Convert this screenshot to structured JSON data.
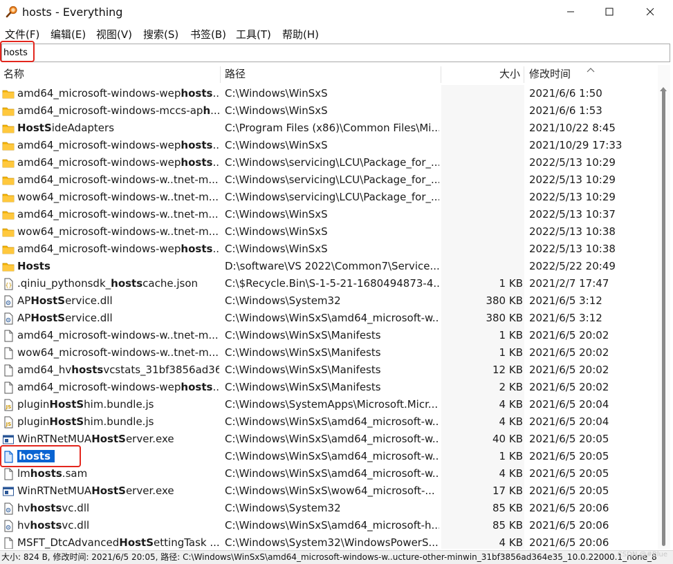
{
  "window": {
    "title": "hosts - Everything",
    "controls": {
      "minimize": "minimize",
      "maximize": "maximize",
      "close": "close"
    }
  },
  "menu": [
    "文件(F)",
    "编辑(E)",
    "视图(V)",
    "搜索(S)",
    "书签(B)",
    "工具(T)",
    "帮助(H)"
  ],
  "search": {
    "value": "hosts",
    "placeholder": ""
  },
  "columns": {
    "name": "名称",
    "path": "路径",
    "size": "大小",
    "modified": "修改时间"
  },
  "sort": {
    "column": "modified",
    "direction": "ascending"
  },
  "colors": {
    "selection": "#0a64d2",
    "annotation": "#e3261d",
    "folder": "#f5b400"
  },
  "rows": [
    {
      "icon": "folder",
      "name_parts": [
        [
          "amd64_microsoft-windows-wep",
          0
        ],
        [
          "hosts",
          1
        ],
        [
          "...",
          0
        ]
      ],
      "path": "C:\\Windows\\WinSxS",
      "size": "",
      "modified": "2021/6/6 1:50"
    },
    {
      "icon": "folder",
      "name_parts": [
        [
          "amd64_microsoft-windows-mccs-ap",
          0
        ],
        [
          "h",
          1
        ],
        [
          "...",
          0
        ]
      ],
      "path": "C:\\Windows\\WinSxS",
      "size": "",
      "modified": "2021/6/6 1:53"
    },
    {
      "icon": "folder",
      "name_parts": [
        [
          "HostS",
          1
        ],
        [
          "ideAdapters",
          0
        ]
      ],
      "path": "C:\\Program Files (x86)\\Common Files\\Mi...",
      "size": "",
      "modified": "2021/10/22 8:45"
    },
    {
      "icon": "folder",
      "name_parts": [
        [
          "amd64_microsoft-windows-wep",
          0
        ],
        [
          "hosts",
          1
        ],
        [
          "...",
          0
        ]
      ],
      "path": "C:\\Windows\\WinSxS",
      "size": "",
      "modified": "2021/10/29 17:33"
    },
    {
      "icon": "folder",
      "name_parts": [
        [
          "amd64_microsoft-windows-wep",
          0
        ],
        [
          "hosts",
          1
        ],
        [
          "...",
          0
        ]
      ],
      "path": "C:\\Windows\\servicing\\LCU\\Package_for_...",
      "size": "",
      "modified": "2022/5/13 10:29"
    },
    {
      "icon": "folder",
      "name_parts": [
        [
          "amd64_microsoft-windows-w..tnet-m...",
          0
        ]
      ],
      "path": "C:\\Windows\\servicing\\LCU\\Package_for_...",
      "size": "",
      "modified": "2022/5/13 10:29"
    },
    {
      "icon": "folder",
      "name_parts": [
        [
          "wow64_microsoft-windows-w..tnet-m...",
          0
        ]
      ],
      "path": "C:\\Windows\\servicing\\LCU\\Package_for_...",
      "size": "",
      "modified": "2022/5/13 10:29"
    },
    {
      "icon": "folder",
      "name_parts": [
        [
          "amd64_microsoft-windows-w..tnet-m...",
          0
        ]
      ],
      "path": "C:\\Windows\\WinSxS",
      "size": "",
      "modified": "2022/5/13 10:37"
    },
    {
      "icon": "folder",
      "name_parts": [
        [
          "wow64_microsoft-windows-w..tnet-m...",
          0
        ]
      ],
      "path": "C:\\Windows\\WinSxS",
      "size": "",
      "modified": "2022/5/13 10:38"
    },
    {
      "icon": "folder",
      "name_parts": [
        [
          "amd64_microsoft-windows-wep",
          0
        ],
        [
          "hosts",
          1
        ],
        [
          "...",
          0
        ]
      ],
      "path": "C:\\Windows\\WinSxS",
      "size": "",
      "modified": "2022/5/13 10:38"
    },
    {
      "icon": "folder",
      "name_parts": [
        [
          "Hosts",
          1
        ]
      ],
      "path": "D:\\software\\VS 2022\\Common7\\Service...",
      "size": "",
      "modified": "2022/5/22 20:49"
    },
    {
      "icon": "json",
      "name_parts": [
        [
          ".qiniu_pythonsdk_",
          0
        ],
        [
          "hosts",
          1
        ],
        [
          "cache.json",
          0
        ]
      ],
      "path": "C:\\$Recycle.Bin\\S-1-5-21-1680494873-4...",
      "size": "1 KB",
      "modified": "2021/2/7 17:47"
    },
    {
      "icon": "dll",
      "name_parts": [
        [
          "AP",
          0
        ],
        [
          "HostS",
          1
        ],
        [
          "ervice.dll",
          0
        ]
      ],
      "path": "C:\\Windows\\System32",
      "size": "380 KB",
      "modified": "2021/6/5 3:12"
    },
    {
      "icon": "dll",
      "name_parts": [
        [
          "AP",
          0
        ],
        [
          "HostS",
          1
        ],
        [
          "ervice.dll",
          0
        ]
      ],
      "path": "C:\\Windows\\WinSxS\\amd64_microsoft-w...",
      "size": "380 KB",
      "modified": "2021/6/5 3:12"
    },
    {
      "icon": "file",
      "name_parts": [
        [
          "amd64_microsoft-windows-w..tnet-m...",
          0
        ]
      ],
      "path": "C:\\Windows\\WinSxS\\Manifests",
      "size": "1 KB",
      "modified": "2021/6/5 20:02"
    },
    {
      "icon": "file",
      "name_parts": [
        [
          "wow64_microsoft-windows-w..tnet-m...",
          0
        ]
      ],
      "path": "C:\\Windows\\WinSxS\\Manifests",
      "size": "1 KB",
      "modified": "2021/6/5 20:02"
    },
    {
      "icon": "file",
      "name_parts": [
        [
          "amd64_hv",
          0
        ],
        [
          "hosts",
          1
        ],
        [
          "vcstats_31bf3856ad36...",
          0
        ]
      ],
      "path": "C:\\Windows\\WinSxS\\Manifests",
      "size": "12 KB",
      "modified": "2021/6/5 20:02"
    },
    {
      "icon": "file",
      "name_parts": [
        [
          "amd64_microsoft-windows-wep",
          0
        ],
        [
          "hosts",
          1
        ],
        [
          "...",
          0
        ]
      ],
      "path": "C:\\Windows\\WinSxS\\Manifests",
      "size": "2 KB",
      "modified": "2021/6/5 20:02"
    },
    {
      "icon": "js",
      "name_parts": [
        [
          "plugin",
          0
        ],
        [
          "HostS",
          1
        ],
        [
          "him.bundle.js",
          0
        ]
      ],
      "path": "C:\\Windows\\SystemApps\\Microsoft.Micr...",
      "size": "4 KB",
      "modified": "2021/6/5 20:04"
    },
    {
      "icon": "js",
      "name_parts": [
        [
          "plugin",
          0
        ],
        [
          "HostS",
          1
        ],
        [
          "him.bundle.js",
          0
        ]
      ],
      "path": "C:\\Windows\\WinSxS\\amd64_microsoft-w...",
      "size": "4 KB",
      "modified": "2021/6/5 20:04"
    },
    {
      "icon": "exe",
      "name_parts": [
        [
          "WinRTNetMUA",
          0
        ],
        [
          "HostS",
          1
        ],
        [
          "erver.exe",
          0
        ]
      ],
      "path": "C:\\Windows\\WinSxS\\amd64_microsoft-w...",
      "size": "40 KB",
      "modified": "2021/6/5 20:05"
    },
    {
      "icon": "file-selected",
      "selected": true,
      "name_parts": [
        [
          "hosts",
          1
        ]
      ],
      "path": "C:\\Windows\\WinSxS\\amd64_microsoft-w...",
      "size": "1 KB",
      "modified": "2021/6/5 20:05"
    },
    {
      "icon": "file",
      "name_parts": [
        [
          "lm",
          0
        ],
        [
          "hosts",
          1
        ],
        [
          ".sam",
          0
        ]
      ],
      "path": "C:\\Windows\\WinSxS\\amd64_microsoft-w...",
      "size": "4 KB",
      "modified": "2021/6/5 20:05"
    },
    {
      "icon": "exe",
      "name_parts": [
        [
          "WinRTNetMUA",
          0
        ],
        [
          "HostS",
          1
        ],
        [
          "erver.exe",
          0
        ]
      ],
      "path": "C:\\Windows\\WinSxS\\wow64_microsoft-...",
      "size": "17 KB",
      "modified": "2021/6/5 20:05"
    },
    {
      "icon": "dll",
      "name_parts": [
        [
          "hv",
          0
        ],
        [
          "hosts",
          1
        ],
        [
          "vc.dll",
          0
        ]
      ],
      "path": "C:\\Windows\\System32",
      "size": "85 KB",
      "modified": "2021/6/5 20:06"
    },
    {
      "icon": "dll",
      "name_parts": [
        [
          "hv",
          0
        ],
        [
          "hosts",
          1
        ],
        [
          "vc.dll",
          0
        ]
      ],
      "path": "C:\\Windows\\WinSxS\\amd64_microsoft-h...",
      "size": "85 KB",
      "modified": "2021/6/5 20:06"
    },
    {
      "icon": "file",
      "name_parts": [
        [
          "MSFT_DtcAdvanced",
          0
        ],
        [
          "HostS",
          1
        ],
        [
          "ettingTask ...",
          0
        ]
      ],
      "path": "C:\\Windows\\System32\\WindowsPowerS...",
      "size": "4 KB",
      "modified": "2021/6/5 20:06"
    }
  ],
  "status": {
    "text": "大小: 824 B, 修改时间: 2021/6/5 20:05, 路径: C:\\Windows\\WinSxS\\amd64_microsoft-windows-w..ucture-other-minwin_31bf3856ad364e35_10.0.22000.1_none_8"
  },
  "watermark": "CSDN @#Blue"
}
